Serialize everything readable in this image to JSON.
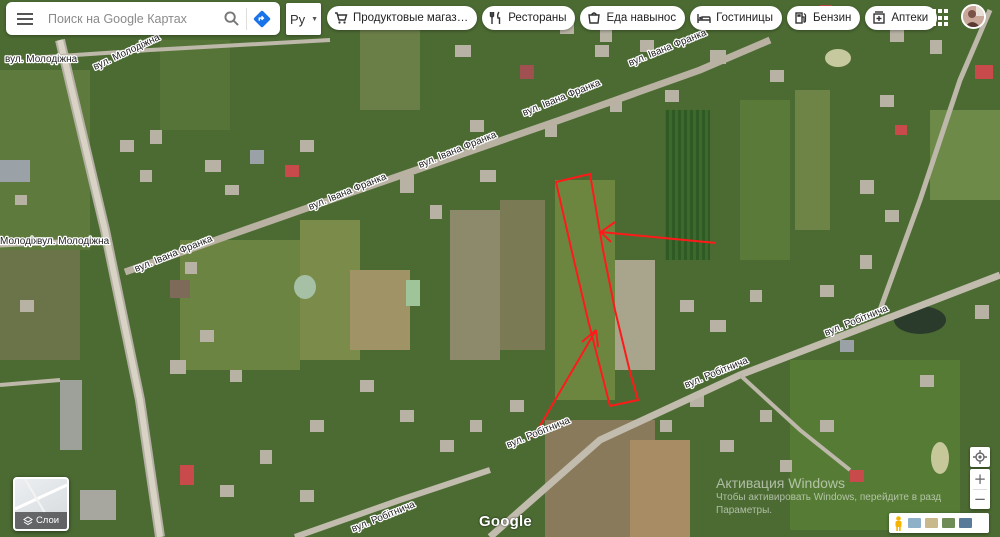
{
  "search": {
    "placeholder": "Поиск на Google Картах"
  },
  "language": {
    "selected": "Ру"
  },
  "chips": [
    {
      "label": "Продуктовые магаз…",
      "icon": "cart-icon"
    },
    {
      "label": "Рестораны",
      "icon": "restaurant-icon"
    },
    {
      "label": "Еда навынос",
      "icon": "takeout-icon"
    },
    {
      "label": "Гостиницы",
      "icon": "hotel-icon"
    },
    {
      "label": "Бензин",
      "icon": "gas-station-icon"
    },
    {
      "label": "Аптеки",
      "icon": "pharmacy-icon"
    }
  ],
  "streets": {
    "molodizhna_1": "вул. Молодіжна",
    "molodizhna_2": "вул. Молодіжна",
    "molodizhna_3": "Молодіжна",
    "molodizhna_4": "вул. Молодіжна",
    "franka_1": "вул. Івана Франка",
    "franka_2": "вул. Івана Франка",
    "franka_3": "вул. Івана Франка",
    "franka_4": "вул. Івана Франка",
    "robitnycha_1": "вул. Робітнича",
    "robitnycha_2": "вул. Робітнича",
    "robitnycha_3": "вул. Робітнича",
    "robitnycha_4": "вул. Робітнича"
  },
  "layers": {
    "label": "Слои"
  },
  "brand": {
    "logo": "Google"
  },
  "watermark": {
    "title": "Активация Windows",
    "line1": "Чтобы активировать Windows, перейдите в разд",
    "line2": "Параметры."
  },
  "colors": {
    "annotation": "#ff1a1a",
    "accent": "#1a73e8"
  }
}
